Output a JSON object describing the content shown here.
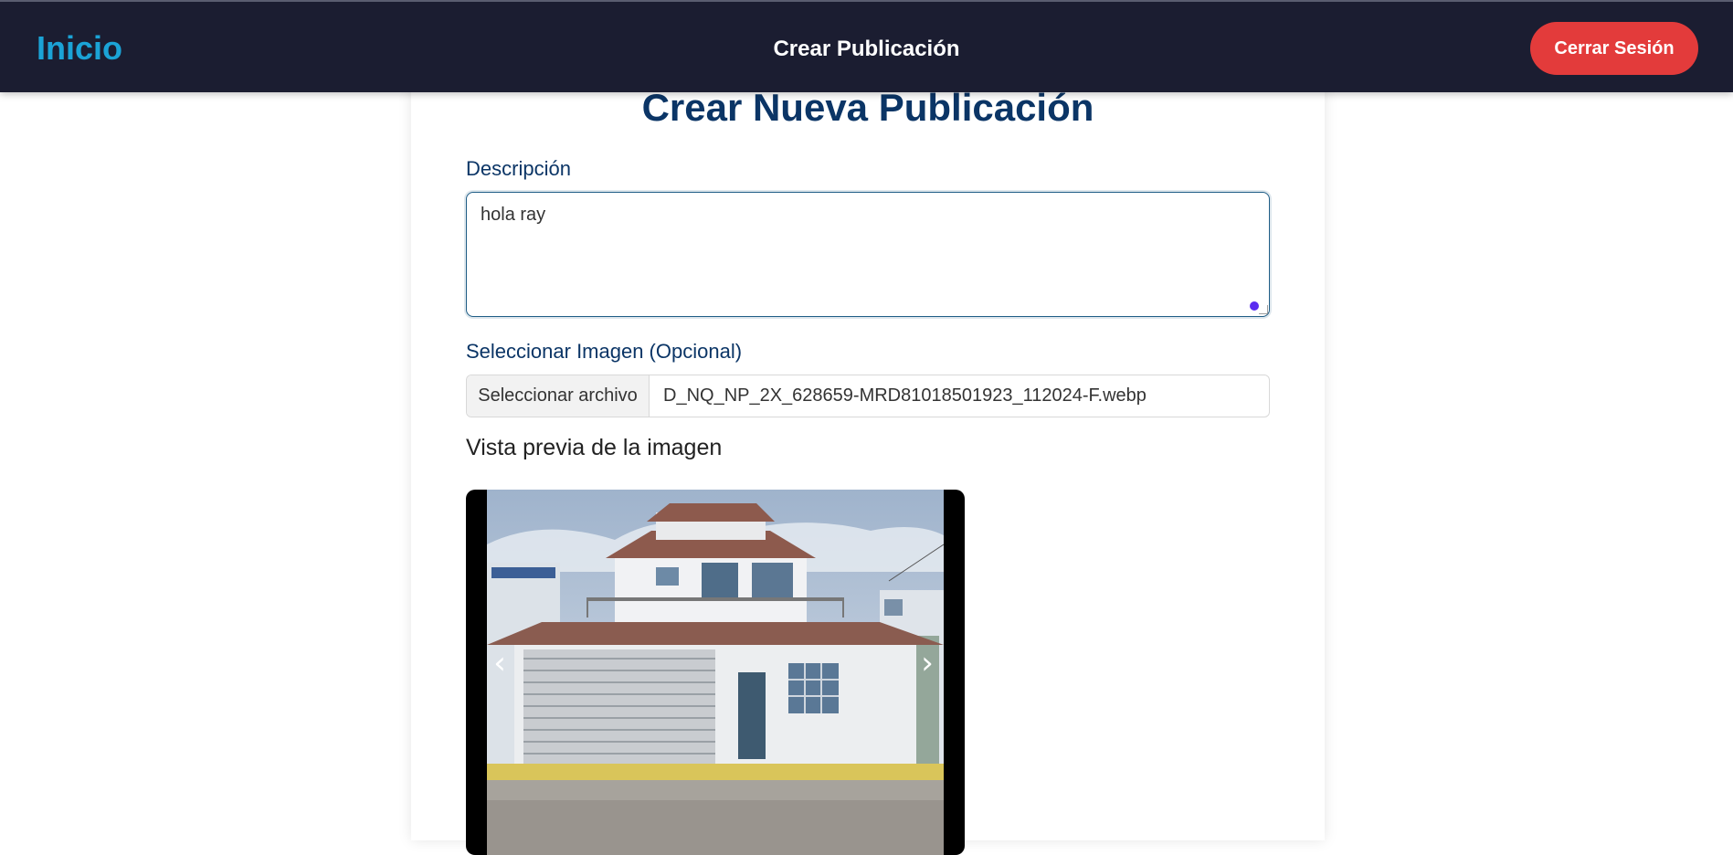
{
  "navbar": {
    "home": "Inicio",
    "title": "Crear Publicación",
    "logout": "Cerrar Sesión"
  },
  "form": {
    "title": "Crear Nueva Publicación",
    "description_label": "Descripción",
    "description_value": "hola ray",
    "image_label": "Seleccionar Imagen (Opcional)",
    "file_button": "Seleccionar archivo",
    "file_name": "D_NQ_NP_2X_628659-MRD81018501923_112024-F.webp",
    "preview_label": "Vista previa de la imagen"
  },
  "preview": {
    "prev_icon": "chevron-left-icon",
    "next_icon": "chevron-right-icon"
  },
  "colors": {
    "navbar_bg": "#1b1d31",
    "home_link": "#1ba3d6",
    "logout_bg": "#e33b3b",
    "heading": "#0b3566"
  }
}
